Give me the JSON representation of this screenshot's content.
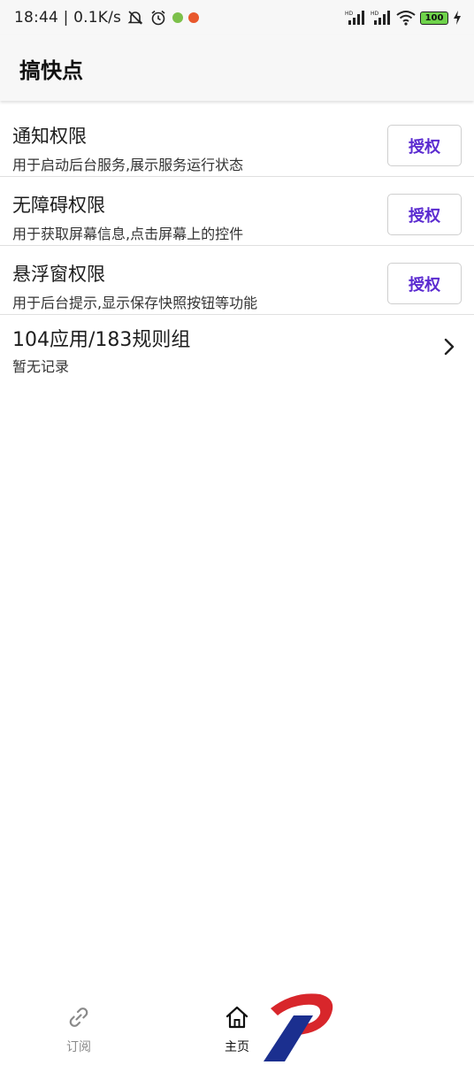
{
  "status_bar": {
    "time_speed": "18:44 | 0.1K/s",
    "battery": "100"
  },
  "app_bar": {
    "title": "搞快点"
  },
  "permissions": [
    {
      "title": "通知权限",
      "description": "用于启动后台服务,展示服务运行状态",
      "button": "授权"
    },
    {
      "title": "无障碍权限",
      "description": "用于获取屏幕信息,点击屏幕上的控件",
      "button": "授权"
    },
    {
      "title": "悬浮窗权限",
      "description": "用于后台提示,显示保存快照按钮等功能",
      "button": "授权"
    }
  ],
  "stats": {
    "title": "104应用/183规则组",
    "description": "暂无记录"
  },
  "bottom_nav": {
    "items": [
      {
        "label": "订阅",
        "icon": "link-icon"
      },
      {
        "label": "主页",
        "icon": "home-icon"
      }
    ]
  },
  "colors": {
    "accent": "#5b2bd0",
    "app_bar_bg": "#f7f7f7"
  }
}
